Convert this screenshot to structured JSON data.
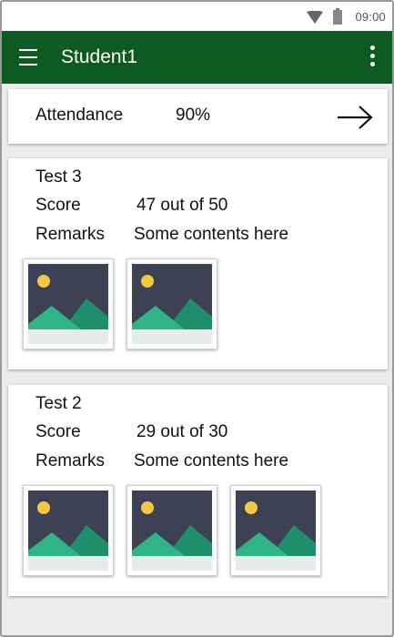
{
  "status_bar": {
    "time": "09:00",
    "wifi_icon": "wifi-icon",
    "battery_icon": "battery-icon"
  },
  "app_bar": {
    "title": "Student1",
    "menu_icon": "hamburger-menu-icon",
    "overflow_icon": "more-vert-icon"
  },
  "attendance": {
    "label": "Attendance",
    "value": "90%",
    "action_icon": "arrow-right-icon"
  },
  "tests": [
    {
      "title": "Test 3",
      "score_label": "Score",
      "score_value": "47 out of 50",
      "remarks_label": "Remarks",
      "remarks_value": "Some contents here",
      "image_count": 2
    },
    {
      "title": "Test 2",
      "score_label": "Score",
      "score_value": "29 out of 30",
      "remarks_label": "Remarks",
      "remarks_value": "Some contents here",
      "image_count": 3
    }
  ],
  "colors": {
    "app_bar": "#0e5a23",
    "image_sky": "#3d4153",
    "image_sun": "#f5c844",
    "image_mountain_front": "#2fb585",
    "image_mountain_back": "#1f8f6b",
    "image_ground": "#e6ece9"
  }
}
